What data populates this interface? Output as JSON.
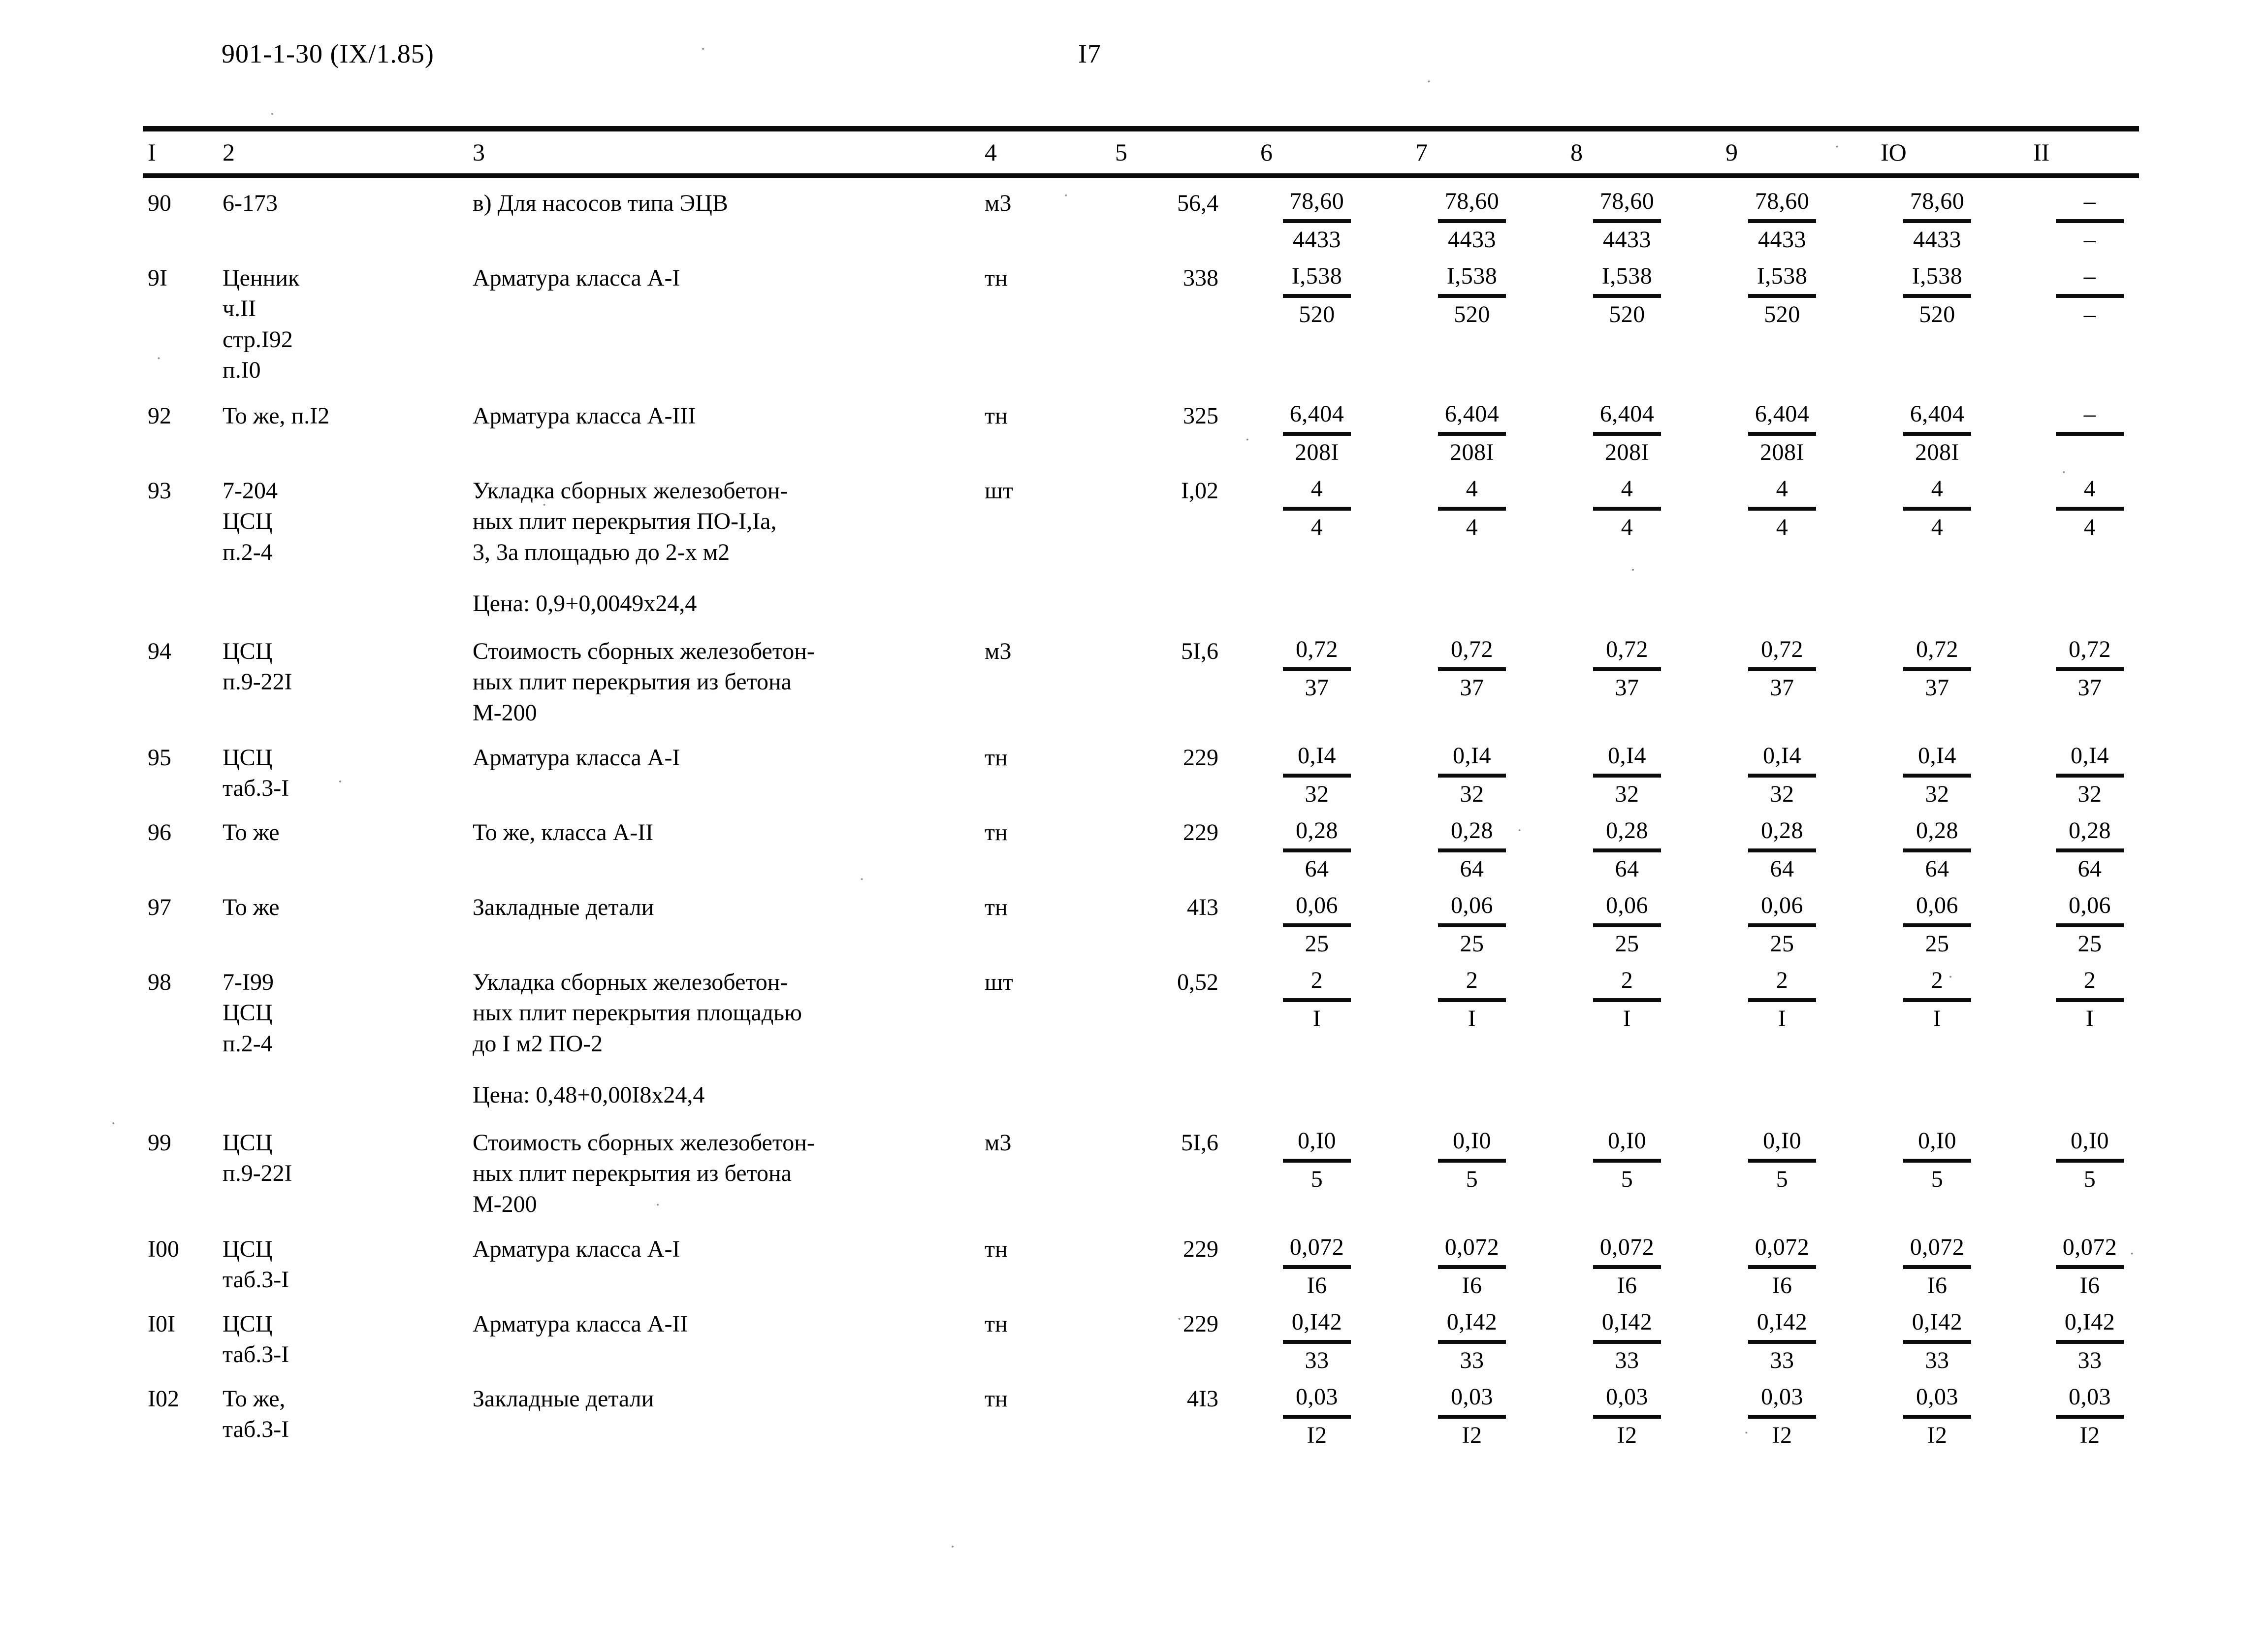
{
  "header": {
    "doc_code": "901-1-30 (IX/1.85)",
    "page_number": "I7"
  },
  "table": {
    "column_numbers": [
      "I",
      "2",
      "3",
      "4",
      "5",
      "6",
      "7",
      "8",
      "9",
      "IO",
      "II"
    ],
    "rows": [
      {
        "no": "90",
        "ref": "6-173",
        "desc": "в) Для насосов типа ЭЦВ",
        "unit": "м3",
        "qty": "56,4",
        "note": "",
        "prices": [
          {
            "num": "78,60",
            "den": "4433"
          },
          {
            "num": "78,60",
            "den": "4433"
          },
          {
            "num": "78,60",
            "den": "4433"
          },
          {
            "num": "78,60",
            "den": "4433"
          },
          {
            "num": "78,60",
            "den": "4433"
          },
          {
            "num": "–",
            "den": "–"
          }
        ]
      },
      {
        "no": "9I",
        "ref": "Ценник\nч.II\nстр.I92\nп.I0",
        "desc": "Арматура класса А-I",
        "unit": "тн",
        "qty": "338",
        "note": "",
        "prices": [
          {
            "num": "I,538",
            "den": "520"
          },
          {
            "num": "I,538",
            "den": "520"
          },
          {
            "num": "I,538",
            "den": "520"
          },
          {
            "num": "I,538",
            "den": "520"
          },
          {
            "num": "I,538",
            "den": "520"
          },
          {
            "num": "–",
            "den": "–"
          }
        ]
      },
      {
        "no": "92",
        "ref": "То же, п.I2",
        "desc": "Арматура класса А-III",
        "unit": "тн",
        "qty": "325",
        "note": "",
        "prices": [
          {
            "num": "6,404",
            "den": "208I"
          },
          {
            "num": "6,404",
            "den": "208I"
          },
          {
            "num": "6,404",
            "den": "208I"
          },
          {
            "num": "6,404",
            "den": "208I"
          },
          {
            "num": "6,404",
            "den": "208I"
          },
          {
            "num": "–",
            "den": ""
          }
        ]
      },
      {
        "no": "93",
        "ref": "7-204\nЦСЦ\nп.2-4",
        "desc": "Укладка сборных железобетон-\nных плит перекрытия ПО-I,Iа,\n3, 3а площадью до 2-х м2",
        "unit": "шт",
        "qty": "I,02",
        "note": "Цена: 0,9+0,0049х24,4",
        "prices": [
          {
            "num": "4",
            "den": "4"
          },
          {
            "num": "4",
            "den": "4"
          },
          {
            "num": "4",
            "den": "4"
          },
          {
            "num": "4",
            "den": "4"
          },
          {
            "num": "4",
            "den": "4"
          },
          {
            "num": "4",
            "den": "4"
          }
        ]
      },
      {
        "no": "94",
        "ref": "ЦСЦ\nп.9-22I",
        "desc": "Стоимость сборных железобетон-\nных плит перекрытия из бетона\nМ-200",
        "unit": "м3",
        "qty": "5I,6",
        "note": "",
        "prices": [
          {
            "num": "0,72",
            "den": "37"
          },
          {
            "num": "0,72",
            "den": "37"
          },
          {
            "num": "0,72",
            "den": "37"
          },
          {
            "num": "0,72",
            "den": "37"
          },
          {
            "num": "0,72",
            "den": "37"
          },
          {
            "num": "0,72",
            "den": "37"
          }
        ]
      },
      {
        "no": "95",
        "ref": "ЦСЦ\nтаб.3-I",
        "desc": "Арматура класса А-I",
        "unit": "тн",
        "qty": "229",
        "note": "",
        "prices": [
          {
            "num": "0,I4",
            "den": "32"
          },
          {
            "num": "0,I4",
            "den": "32"
          },
          {
            "num": "0,I4",
            "den": "32"
          },
          {
            "num": "0,I4",
            "den": "32"
          },
          {
            "num": "0,I4",
            "den": "32"
          },
          {
            "num": "0,I4",
            "den": "32"
          }
        ]
      },
      {
        "no": "96",
        "ref": "То же",
        "desc": "То же, класса А-II",
        "unit": "тн",
        "qty": "229",
        "note": "",
        "prices": [
          {
            "num": "0,28",
            "den": "64"
          },
          {
            "num": "0,28",
            "den": "64"
          },
          {
            "num": "0,28",
            "den": "64"
          },
          {
            "num": "0,28",
            "den": "64"
          },
          {
            "num": "0,28",
            "den": "64"
          },
          {
            "num": "0,28",
            "den": "64"
          }
        ]
      },
      {
        "no": "97",
        "ref": "То же",
        "desc": "Закладные детали",
        "unit": "тн",
        "qty": "4I3",
        "note": "",
        "prices": [
          {
            "num": "0,06",
            "den": "25"
          },
          {
            "num": "0,06",
            "den": "25"
          },
          {
            "num": "0,06",
            "den": "25"
          },
          {
            "num": "0,06",
            "den": "25"
          },
          {
            "num": "0,06",
            "den": "25"
          },
          {
            "num": "0,06",
            "den": "25"
          }
        ]
      },
      {
        "no": "98",
        "ref": "7-I99\nЦСЦ\nп.2-4",
        "desc": "Укладка сборных железобетон-\nных плит перекрытия площадью\nдо I м2 ПО-2",
        "unit": "шт",
        "qty": "0,52",
        "note": "Цена: 0,48+0,00I8х24,4",
        "prices": [
          {
            "num": "2",
            "den": "I"
          },
          {
            "num": "2",
            "den": "I"
          },
          {
            "num": "2",
            "den": "I"
          },
          {
            "num": "2",
            "den": "I"
          },
          {
            "num": "2",
            "den": "I"
          },
          {
            "num": "2",
            "den": "I"
          }
        ]
      },
      {
        "no": "99",
        "ref": "ЦСЦ\nп.9-22I",
        "desc": "Стоимость сборных железобетон-\nных плит перекрытия из бетона\nМ-200",
        "unit": "м3",
        "qty": "5I,6",
        "note": "",
        "prices": [
          {
            "num": "0,I0",
            "den": "5"
          },
          {
            "num": "0,I0",
            "den": "5"
          },
          {
            "num": "0,I0",
            "den": "5"
          },
          {
            "num": "0,I0",
            "den": "5"
          },
          {
            "num": "0,I0",
            "den": "5"
          },
          {
            "num": "0,I0",
            "den": "5"
          }
        ]
      },
      {
        "no": "I00",
        "ref": "ЦСЦ\nтаб.3-I",
        "desc": "Арматура класса А-I",
        "unit": "тн",
        "qty": "229",
        "note": "",
        "prices": [
          {
            "num": "0,072",
            "den": "I6"
          },
          {
            "num": "0,072",
            "den": "I6"
          },
          {
            "num": "0,072",
            "den": "I6"
          },
          {
            "num": "0,072",
            "den": "I6"
          },
          {
            "num": "0,072",
            "den": "I6"
          },
          {
            "num": "0,072",
            "den": "I6"
          }
        ]
      },
      {
        "no": "I0I",
        "ref": "ЦСЦ\nтаб.3-I",
        "desc": "Арматура класса А-II",
        "unit": "тн",
        "qty": "229",
        "note": "",
        "prices": [
          {
            "num": "0,I42",
            "den": "33"
          },
          {
            "num": "0,I42",
            "den": "33"
          },
          {
            "num": "0,I42",
            "den": "33"
          },
          {
            "num": "0,I42",
            "den": "33"
          },
          {
            "num": "0,I42",
            "den": "33"
          },
          {
            "num": "0,I42",
            "den": "33"
          }
        ]
      },
      {
        "no": "I02",
        "ref": "То же,\nтаб.3-I",
        "desc": "Закладные детали",
        "unit": "тн",
        "qty": "4I3",
        "note": "",
        "prices": [
          {
            "num": "0,03",
            "den": "I2"
          },
          {
            "num": "0,03",
            "den": "I2"
          },
          {
            "num": "0,03",
            "den": "I2"
          },
          {
            "num": "0,03",
            "den": "I2"
          },
          {
            "num": "0,03",
            "den": "I2"
          },
          {
            "num": "0,03",
            "den": "I2"
          }
        ]
      }
    ]
  }
}
